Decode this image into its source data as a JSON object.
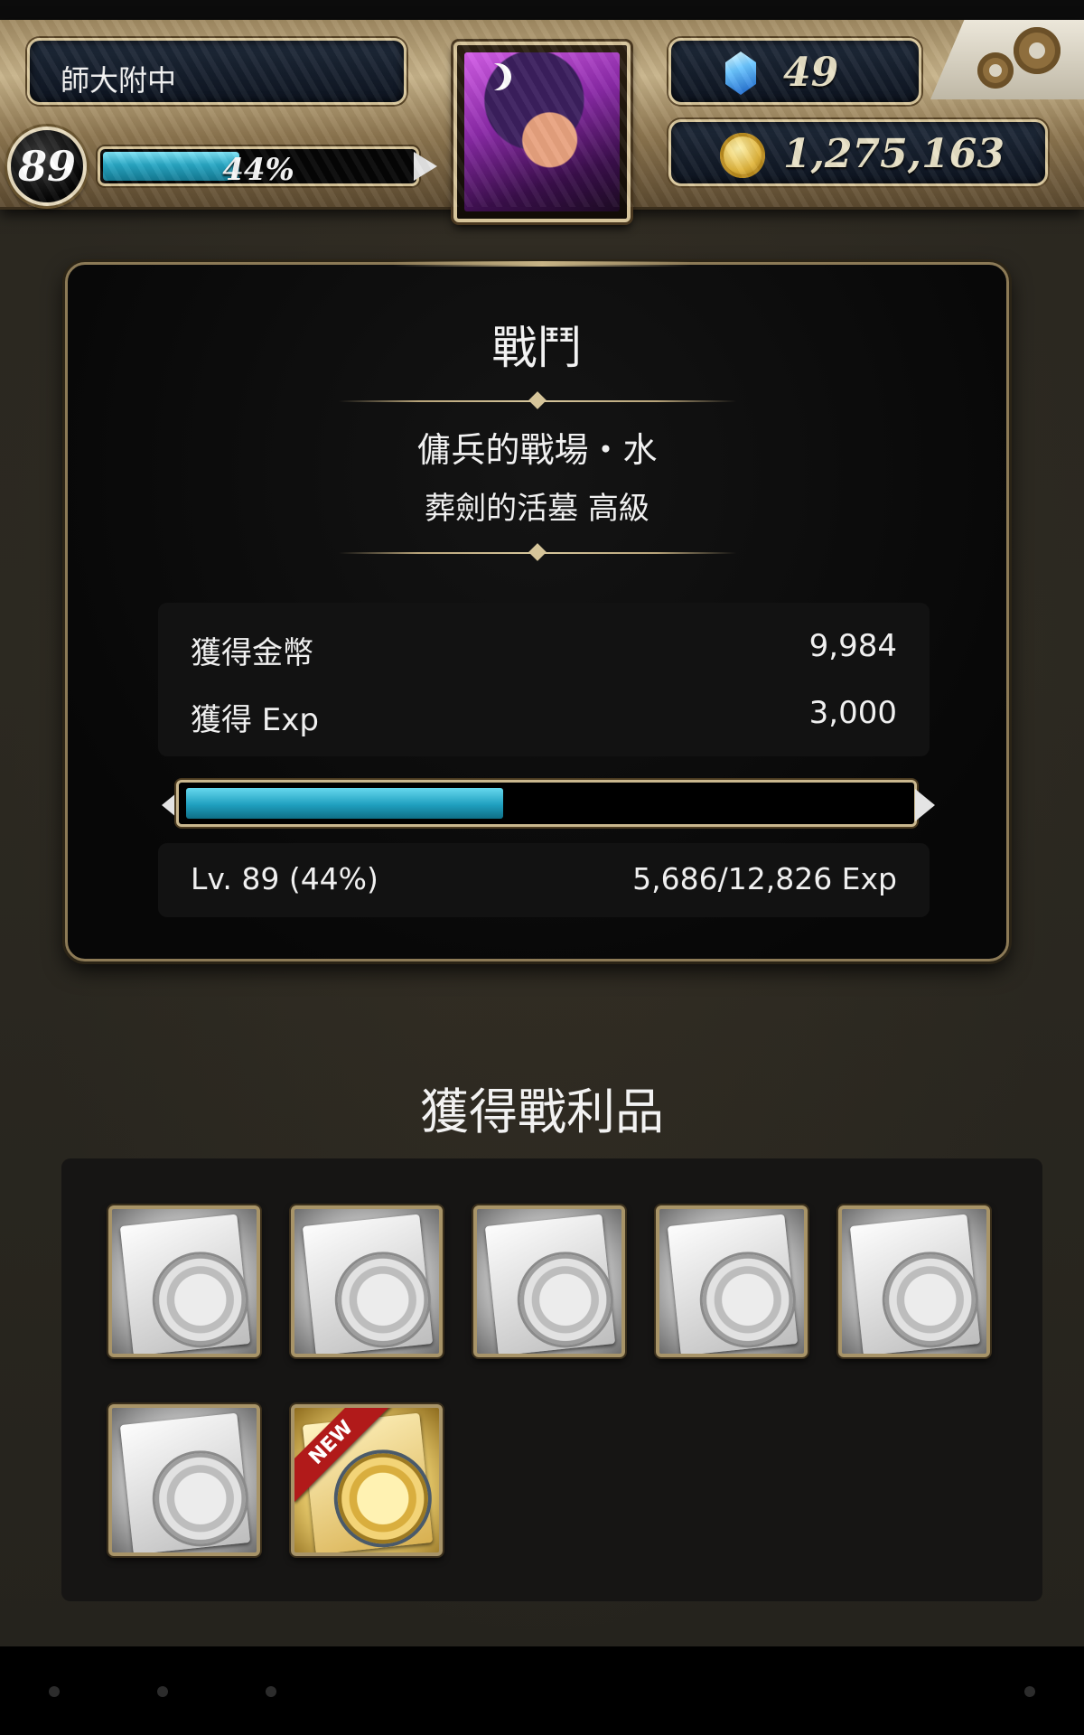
{
  "player": {
    "name": "師大附中",
    "level": "89",
    "exp_percent_label": "44%",
    "exp_fraction": 0.44
  },
  "currency": {
    "gems": "49",
    "coins": "1,275,163"
  },
  "icons": {
    "gem": "blue-crystal-icon",
    "coin": "gold-coin-icon",
    "settings": "gears-icon"
  },
  "battle": {
    "title": "戰鬥",
    "stage_name": "傭兵的戰場・水",
    "stage_difficulty": "葬劍的活墓 高級",
    "rewards": [
      {
        "label": "獲得金幣",
        "value": "9,984"
      },
      {
        "label": "獲得 Exp",
        "value": "3,000"
      }
    ],
    "level_progress": {
      "label": "Lv. 89 (44%)",
      "value": "5,686/12,826 Exp",
      "fraction": 0.44
    }
  },
  "loot": {
    "title": "獲得戰利品",
    "new_label": "NEW",
    "items": [
      {
        "kind": "silver"
      },
      {
        "kind": "silver"
      },
      {
        "kind": "silver"
      },
      {
        "kind": "silver"
      },
      {
        "kind": "silver"
      },
      {
        "kind": "silver"
      },
      {
        "kind": "gold",
        "is_new": true
      }
    ]
  },
  "colors": {
    "exp_bar": "#28a7c4",
    "frame_gold": "#d9c79c",
    "new_ribbon": "#b11a1a"
  }
}
